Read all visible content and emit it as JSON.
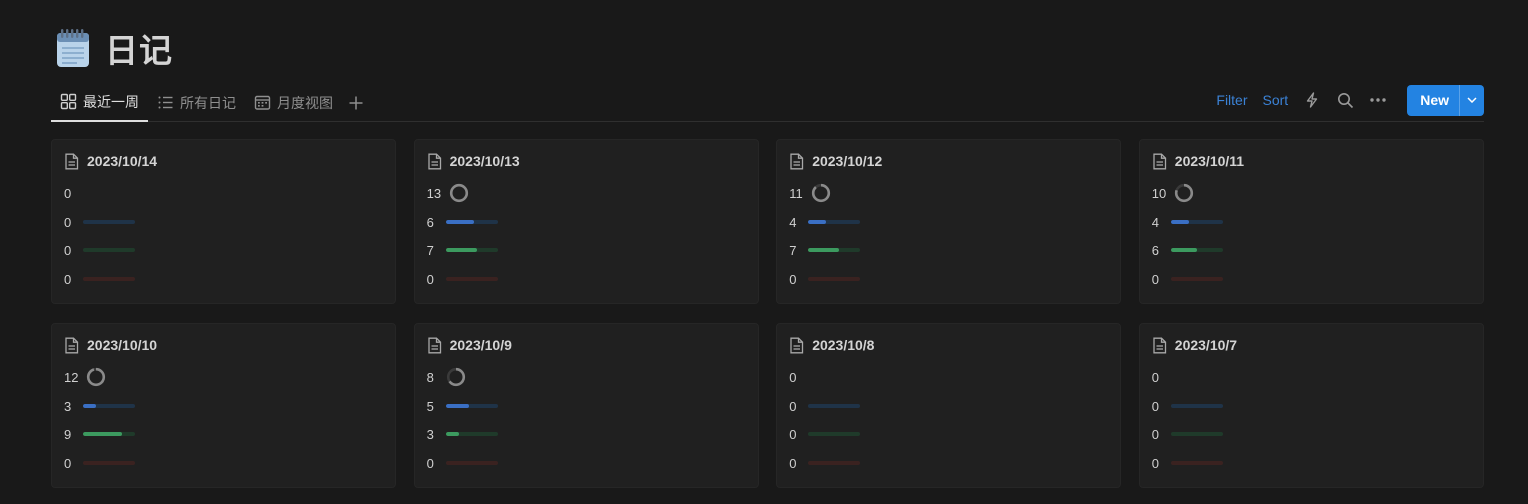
{
  "page": {
    "title": "日记"
  },
  "tabs": [
    {
      "label": "最近一周",
      "icon": "gallery-icon",
      "active": true
    },
    {
      "label": "所有日记",
      "icon": "list-icon",
      "active": false
    },
    {
      "label": "月度视图",
      "icon": "calendar-icon",
      "active": false
    }
  ],
  "toolbar": {
    "filter_label": "Filter",
    "sort_label": "Sort",
    "new_label": "New"
  },
  "colors": {
    "accent": "#2383e2",
    "link": "#3b82d6",
    "blue_bar": "#3a6fc4",
    "green_bar": "#3c9a5f",
    "red_bar": "#7a2f2a",
    "ring": "#8a8a8a"
  },
  "cards": [
    {
      "date": "2023/10/14",
      "ring": {
        "value": "0",
        "fraction": 0
      },
      "blue": {
        "value": "0",
        "fraction": 0
      },
      "green": {
        "value": "0",
        "fraction": 0
      },
      "red": {
        "value": "0",
        "fraction": 0
      }
    },
    {
      "date": "2023/10/13",
      "ring": {
        "value": "13",
        "fraction": 1
      },
      "blue": {
        "value": "6",
        "fraction": 0.55
      },
      "green": {
        "value": "7",
        "fraction": 0.6
      },
      "red": {
        "value": "0",
        "fraction": 0
      }
    },
    {
      "date": "2023/10/12",
      "ring": {
        "value": "11",
        "fraction": 0.88
      },
      "blue": {
        "value": "4",
        "fraction": 0.35
      },
      "green": {
        "value": "7",
        "fraction": 0.6
      },
      "red": {
        "value": "0",
        "fraction": 0
      }
    },
    {
      "date": "2023/10/11",
      "ring": {
        "value": "10",
        "fraction": 0.8
      },
      "blue": {
        "value": "4",
        "fraction": 0.35
      },
      "green": {
        "value": "6",
        "fraction": 0.5
      },
      "red": {
        "value": "0",
        "fraction": 0
      }
    },
    {
      "date": "2023/10/10",
      "ring": {
        "value": "12",
        "fraction": 0.95
      },
      "blue": {
        "value": "3",
        "fraction": 0.25
      },
      "green": {
        "value": "9",
        "fraction": 0.75
      },
      "red": {
        "value": "0",
        "fraction": 0
      }
    },
    {
      "date": "2023/10/9",
      "ring": {
        "value": "8",
        "fraction": 0.65
      },
      "blue": {
        "value": "5",
        "fraction": 0.45
      },
      "green": {
        "value": "3",
        "fraction": 0.25
      },
      "red": {
        "value": "0",
        "fraction": 0
      }
    },
    {
      "date": "2023/10/8",
      "ring": {
        "value": "0",
        "fraction": 0
      },
      "blue": {
        "value": "0",
        "fraction": 0
      },
      "green": {
        "value": "0",
        "fraction": 0
      },
      "red": {
        "value": "0",
        "fraction": 0
      }
    },
    {
      "date": "2023/10/7",
      "ring": {
        "value": "0",
        "fraction": 0
      },
      "blue": {
        "value": "0",
        "fraction": 0
      },
      "green": {
        "value": "0",
        "fraction": 0
      },
      "red": {
        "value": "0",
        "fraction": 0
      }
    }
  ]
}
